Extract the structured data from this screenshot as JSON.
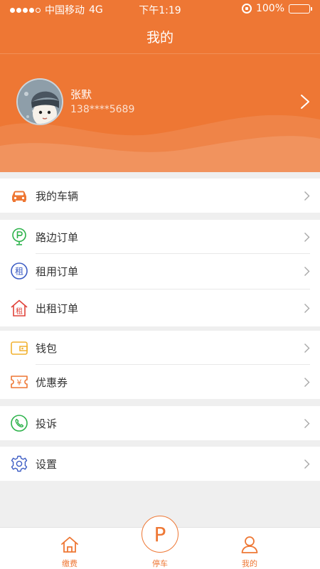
{
  "status_bar": {
    "carrier": "中国移动",
    "network": "4G",
    "time": "下午1:19",
    "battery": "100%",
    "signal_dots_filled": 4
  },
  "nav": {
    "title": "我的"
  },
  "profile": {
    "name": "张默",
    "phone": "138****5689"
  },
  "menu": {
    "vehicles": "我的车辆",
    "roadside_orders": "路边订单",
    "rental_orders": "租用订单",
    "lease_out_orders": "出租订单",
    "wallet": "钱包",
    "coupons": "优惠券",
    "complaint": "投诉",
    "settings": "设置"
  },
  "tabbar": {
    "pay": "缴费",
    "parking_symbol": "P",
    "parking": "停车",
    "mine": "我的"
  },
  "colors": {
    "accent": "#ee7734",
    "background": "#efefef",
    "green": "#2cb24a",
    "blue": "#3c5cc4",
    "red": "#e0433a",
    "yellow": "#f2b230"
  }
}
